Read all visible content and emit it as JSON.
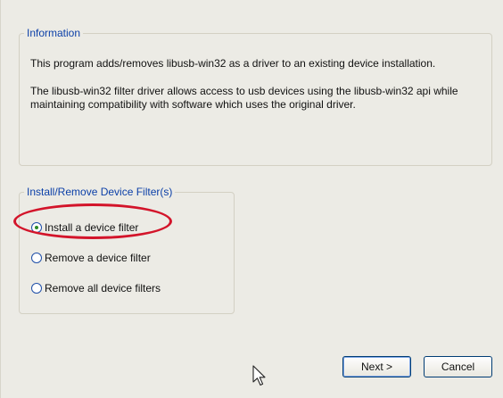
{
  "information": {
    "legend": "Information",
    "paragraph1": "This program adds/removes libusb-win32 as a driver to an existing device installation.",
    "paragraph2": "The libusb-win32 filter driver allows access to usb devices using the libusb-win32 api while maintaining compatibility with software which uses the original driver."
  },
  "filter_group": {
    "legend": "Install/Remove Device Filter(s)",
    "options": [
      {
        "label": "Install a device filter",
        "selected": true
      },
      {
        "label": "Remove a device filter",
        "selected": false
      },
      {
        "label": "Remove all device filters",
        "selected": false
      }
    ]
  },
  "buttons": {
    "next_label": "Next >",
    "cancel_label": "Cancel"
  },
  "colors": {
    "highlight": "#d3142a",
    "legend_text": "#0b3fa8",
    "dialog_bg": "#ecebe5"
  },
  "icons": {
    "cursor": "mouse-pointer-icon",
    "radio_selected": "radio-checked-icon",
    "radio_unselected": "radio-unchecked-icon"
  }
}
